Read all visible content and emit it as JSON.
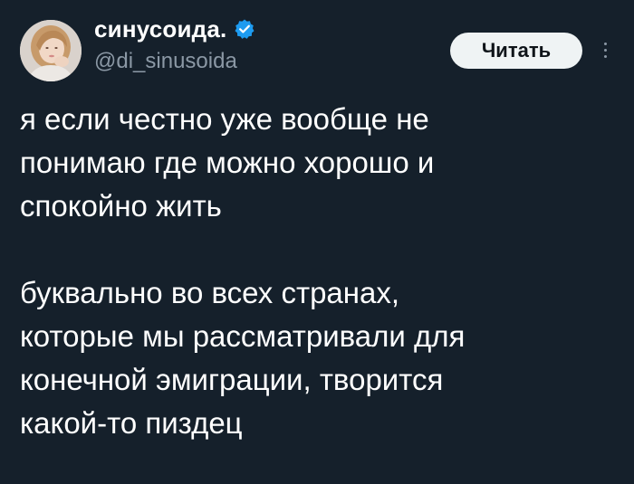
{
  "author": {
    "display_name": "синусоида.",
    "handle": "@di_sinusoida",
    "verified_badge_icon": "verified-badge-icon",
    "avatar_icon": "profile-avatar"
  },
  "actions": {
    "follow_label": "Читать",
    "more_icon": "more-vertical-icon"
  },
  "tweet": {
    "paragraphs": [
      "я если честно уже вообще не\nпонимаю где можно хорошо и\nспокойно жить",
      "буквально во всех странах,\nкоторые мы рассматривали для\nконечной эмиграции, творится\nкакой-то пиздец"
    ]
  },
  "colors": {
    "background": "#15202b",
    "text": "#ffffff",
    "secondary_text": "#8b98a5",
    "verified_blue": "#1d9bf0",
    "button_bg": "#eff3f4"
  }
}
